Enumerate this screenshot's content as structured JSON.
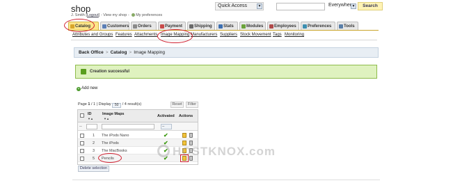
{
  "header": {
    "shop_name": "shop",
    "user_name": "J. Smith",
    "logout_label": "Logout",
    "view_shop_label": "View my shop",
    "preferences_label": "My preferences"
  },
  "search": {
    "quick_access_label": "Quick Access",
    "scope_label": "Everywhere",
    "button_label": "Search",
    "input_value": ""
  },
  "tabs": [
    {
      "label": "Catalog",
      "icon": "catalog-icon",
      "color": "#d9a62a"
    },
    {
      "label": "Customers",
      "icon": "customers-icon",
      "color": "#5b7fb6"
    },
    {
      "label": "Orders",
      "icon": "orders-icon",
      "color": "#8a8a8a"
    },
    {
      "label": "Payment",
      "icon": "payment-icon",
      "color": "#c84a4a"
    },
    {
      "label": "Shipping",
      "icon": "shipping-icon",
      "color": "#6a6a6a"
    },
    {
      "label": "Stats",
      "icon": "stats-icon",
      "color": "#3d6fb0"
    },
    {
      "label": "Modules",
      "icon": "modules-icon",
      "color": "#6aa33a"
    },
    {
      "label": "Employees",
      "icon": "employees-icon",
      "color": "#b04a4a"
    },
    {
      "label": "Preferences",
      "icon": "preferences-icon",
      "color": "#3d8fb0"
    },
    {
      "label": "Tools",
      "icon": "tools-icon",
      "color": "#5a7fa8"
    }
  ],
  "subtabs": [
    "Attributes and Groups",
    "Features",
    "Attachments",
    "Image Mapping",
    "Manufacturers",
    "Suppliers",
    "Stock Movement",
    "Tags",
    "Monitoring"
  ],
  "breadcrumb": {
    "root": "Back Office",
    "section": "Catalog",
    "page": "Image Mapping",
    "separator": ">"
  },
  "message": {
    "text": "Creation successful",
    "icon": "check-icon",
    "color": "#dff2bf"
  },
  "add_new_label": "Add new",
  "pager": {
    "prefix": "Page",
    "page": "1",
    "total_pages": "/ 1",
    "display_label": "| Display",
    "per_page": "50",
    "results": "/ 4 result(s)"
  },
  "reset_label": "Reset",
  "filter_label": "Filter",
  "table": {
    "columns": {
      "id": "ID",
      "name": "Image Maps",
      "active": "Activated",
      "actions": "Actions"
    },
    "filter_row": {
      "id_value": "--",
      "active_value": "--"
    },
    "rows": [
      {
        "id": "1",
        "name": "The iPods Nano",
        "active": true
      },
      {
        "id": "2",
        "name": "The iPods",
        "active": true
      },
      {
        "id": "3",
        "name": "The MacBooks",
        "active": true
      },
      {
        "id": "5",
        "name": "Pencils",
        "active": true
      }
    ]
  },
  "delete_selection_label": "Delete selection",
  "watermark": "HOSTKNOX.com"
}
